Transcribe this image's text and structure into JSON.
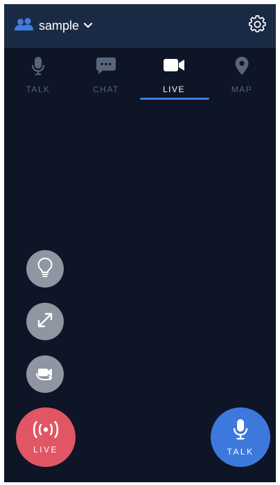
{
  "header": {
    "group_name": "sample",
    "group_icon": "people-icon",
    "dropdown_icon": "chevron-down-icon",
    "settings_icon": "gear-icon"
  },
  "tabs": [
    {
      "label": "TALK",
      "icon": "microphone-icon",
      "active": false
    },
    {
      "label": "CHAT",
      "icon": "chat-bubble-icon",
      "active": false
    },
    {
      "label": "LIVE",
      "icon": "video-camera-icon",
      "active": true
    },
    {
      "label": "MAP",
      "icon": "map-pin-icon",
      "active": false
    }
  ],
  "side_buttons": [
    {
      "icon": "lightbulb-icon"
    },
    {
      "icon": "expand-icon"
    },
    {
      "icon": "switch-camera-icon"
    }
  ],
  "live_button": {
    "label": "LIVE",
    "icon": "broadcast-icon",
    "color": "#e05665"
  },
  "talk_button": {
    "label": "TALK",
    "icon": "microphone-icon",
    "color": "#3d78dc"
  },
  "colors": {
    "background": "#0d1526",
    "header": "#1b2a44",
    "accent": "#3f7de0",
    "inactive_tab": "#58657a",
    "side_button": "#8f96a1"
  }
}
